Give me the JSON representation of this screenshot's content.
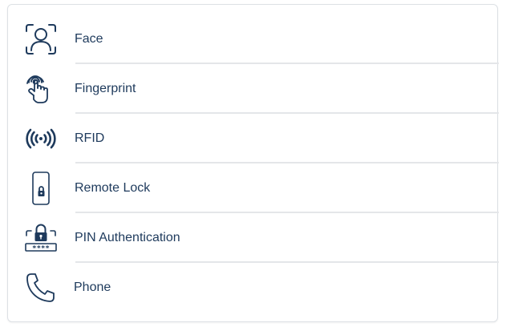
{
  "accent_color": "#1e3a5c",
  "methods": [
    {
      "label": "Face",
      "icon": "face-scan-icon"
    },
    {
      "label": "Fingerprint",
      "icon": "fingerprint-touch-icon"
    },
    {
      "label": "RFID",
      "icon": "rfid-signal-icon"
    },
    {
      "label": "Remote Lock",
      "icon": "phone-lock-icon"
    },
    {
      "label": "PIN Authentication",
      "icon": "pin-lock-icon"
    },
    {
      "label": "Phone",
      "icon": "phone-handset-icon"
    }
  ]
}
